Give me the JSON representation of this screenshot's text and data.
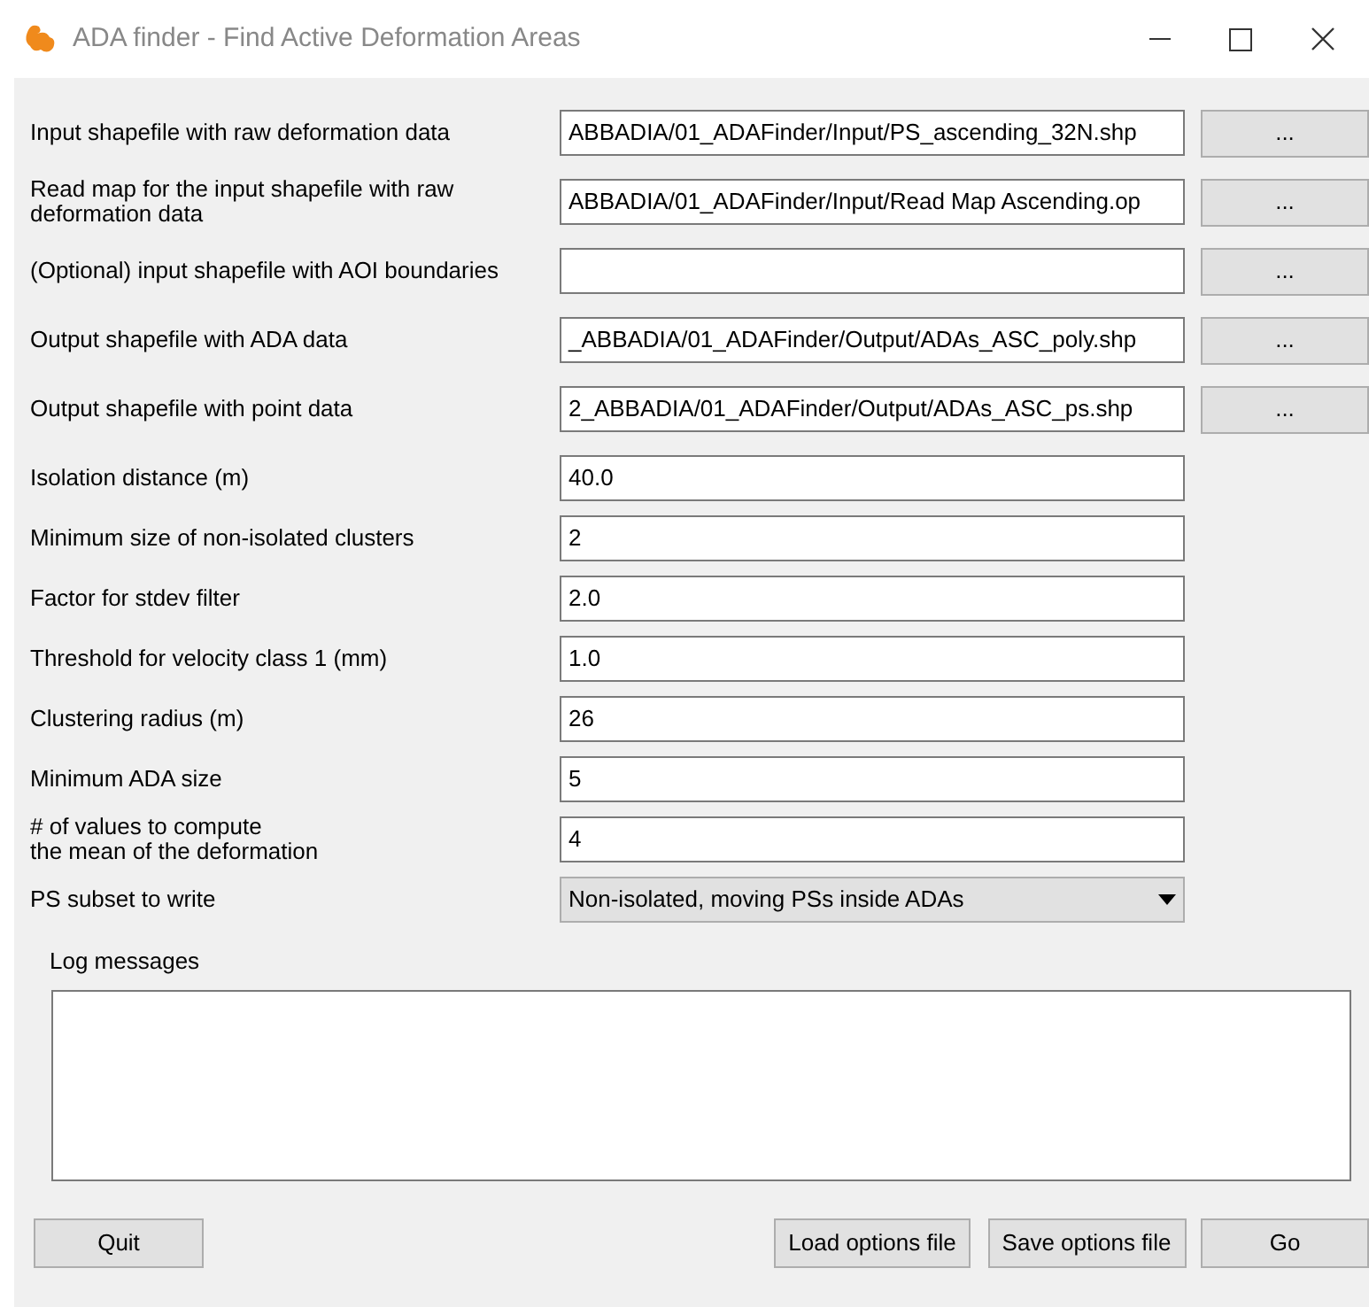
{
  "window": {
    "title": "ADA finder - Find Active Deformation Areas"
  },
  "fields": [
    {
      "kind": "file",
      "label": "Input shapefile with raw deformation data",
      "value": "ABBADIA/01_ADAFinder/Input/PS_ascending_32N.shp",
      "button": "..."
    },
    {
      "kind": "file",
      "label": "Read map for the input shapefile with raw\ndeformation data",
      "value": "ABBADIA/01_ADAFinder/Input/Read Map Ascending.op",
      "button": "..."
    },
    {
      "kind": "file",
      "label": "(Optional) input shapefile with AOI boundaries",
      "button": "..."
    },
    {
      "kind": "file",
      "label": "Output shapefile with ADA data",
      "value": "_ABBADIA/01_ADAFinder/Output/ADAs_ASC_poly.shp",
      "button": "..."
    },
    {
      "kind": "file",
      "label": "Output shapefile with point data",
      "value": "2_ABBADIA/01_ADAFinder/Output/ADAs_ASC_ps.shp",
      "button": "..."
    },
    {
      "kind": "text",
      "label": "Isolation distance (m)",
      "value": "40.0"
    },
    {
      "kind": "text",
      "label": "Minimum size of non-isolated clusters",
      "value": "2"
    },
    {
      "kind": "text",
      "label": "Factor for stdev filter",
      "value": "2.0"
    },
    {
      "kind": "text",
      "label": "Threshold for velocity class 1 (mm)",
      "value": "1.0"
    },
    {
      "kind": "text",
      "label": "Clustering radius (m)",
      "value": "26"
    },
    {
      "kind": "text",
      "label": "Minimum ADA size",
      "value": "5"
    },
    {
      "kind": "text",
      "label": "# of values to compute\nthe mean of the deformation",
      "value": "4"
    },
    {
      "kind": "select",
      "label": "PS subset to write",
      "value": "Non-isolated, moving PSs inside ADAs"
    }
  ],
  "log": {
    "label": "Log messages"
  },
  "buttons": {
    "quit": "Quit",
    "load": "Load options file",
    "save": "Save options file",
    "go": "Go"
  }
}
